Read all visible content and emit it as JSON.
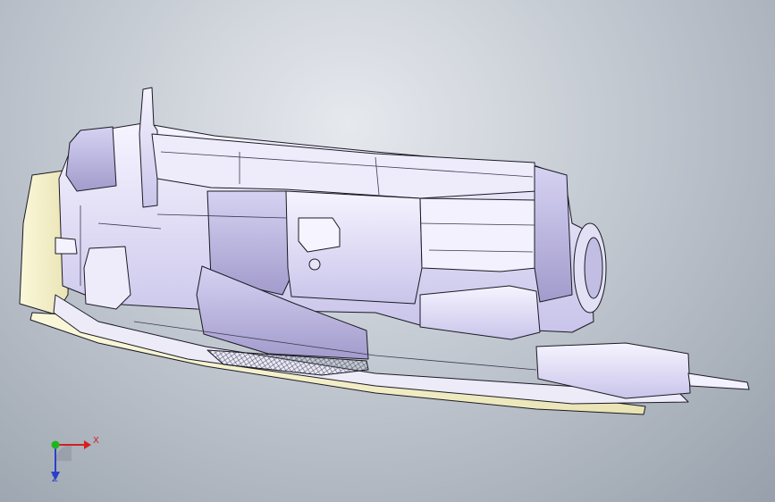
{
  "viewport": {
    "background_top": "#e6e9ee",
    "background_bottom": "#97a0ab"
  },
  "model": {
    "icon": "headlamp-assembly-3d-model",
    "shade_light": "#f4f2ff",
    "shade_mid": "#d8d4f0",
    "shade_dark": "#a9a3cf",
    "lens_color": "#f3efc8",
    "edge_color": "#1a1a24"
  },
  "triad": {
    "x_label": "X",
    "z_label": "Z",
    "x_color": "#d42020",
    "y_color": "#1fb51f",
    "z_color": "#2a3fc9"
  }
}
